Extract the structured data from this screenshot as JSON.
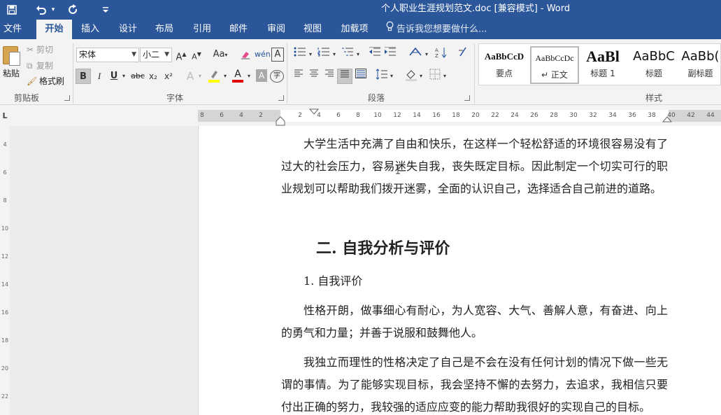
{
  "titlebar": {
    "title": "个人职业生涯规划范文.doc [兼容模式] - Word",
    "save_icon": "floppy-disk-icon",
    "undo_icon": "undo-icon",
    "undo_dropdown": "▾",
    "redo_icon": "redo-icon",
    "customize_icon": "customize-quick-access-icon"
  },
  "tabs": [
    {
      "label": "文件"
    },
    {
      "label": "开始",
      "active": true
    },
    {
      "label": "插入"
    },
    {
      "label": "设计"
    },
    {
      "label": "布局"
    },
    {
      "label": "引用"
    },
    {
      "label": "邮件"
    },
    {
      "label": "审阅"
    },
    {
      "label": "视图"
    },
    {
      "label": "加载项"
    }
  ],
  "tellme": {
    "text": "告诉我您想要做什么...",
    "icon": "lightbulb-icon"
  },
  "clipboard": {
    "paste": "粘贴",
    "cut": "剪切",
    "copy": "复制",
    "format_painter": "格式刷",
    "group_label": "剪贴板"
  },
  "font": {
    "font_name": "宋体",
    "font_size": "小二",
    "grow": "A",
    "shrink": "A",
    "case": "Aa",
    "bold": "B",
    "italic": "I",
    "underline": "U",
    "strike": "abc",
    "subscript": "x₂",
    "superscript": "x²",
    "text_effect": "A",
    "font_color": "A",
    "char_shading": "A",
    "enclose": "字",
    "phonetic": "wén",
    "border": "A",
    "group_label": "字体"
  },
  "paragraph": {
    "group_label": "段落"
  },
  "styles": {
    "group_label": "样式",
    "items": [
      {
        "sample": "AaBbCcD",
        "name": "要点"
      },
      {
        "sample": "AaBbCcDc",
        "name": "↵ 正文"
      },
      {
        "sample": "AaBl",
        "name": "标题 1"
      },
      {
        "sample": "AaBbC",
        "name": "标题"
      },
      {
        "sample": "AaBb(",
        "name": "副标题"
      }
    ]
  },
  "ruler": {
    "corner": "L",
    "ticks": [
      "8",
      "6",
      "4",
      "2",
      "",
      "2",
      "4",
      "6",
      "8",
      "10",
      "12",
      "14",
      "16",
      "18",
      "20",
      "22",
      "24",
      "26",
      "28",
      "30",
      "32",
      "34",
      "36",
      "38",
      "40",
      "42",
      "44"
    ],
    "vticks": [
      "4",
      "6",
      "8",
      "10",
      "12",
      "14",
      "16",
      "18",
      "20",
      "22"
    ]
  },
  "document": {
    "para1": "大学生活中充满了自由和快乐，在这样一个轻松舒适的环境很容易没有了过大的社会压力，容易迷失自我，丧失既定目标。因此制定一个切实可行的职业规划可以帮助我们拨开迷雾，全面的认识自己，选择适合自己前进的道路。",
    "heading": "二. 自我分析与评价",
    "item1": "1.  自我评价",
    "para2": "性格开朗，做事细心有耐心，为人宽容、大气、善解人意，有奋进、向上的勇气和力量；并善于说服和鼓舞他人。",
    "para3": "我独立而理性的性格决定了自己是不会在没有任何计划的情况下做一些无谓的事情。为了能够实现目标，我会坚持不懈的去努力，去追求，我相信只要付出正确的努力，我较强的适应应变的能力帮助我很好的实现自己的目标。"
  },
  "colors": {
    "brand": "#2b579a",
    "highlight": "#ffff00",
    "font_color": "#e00000"
  }
}
